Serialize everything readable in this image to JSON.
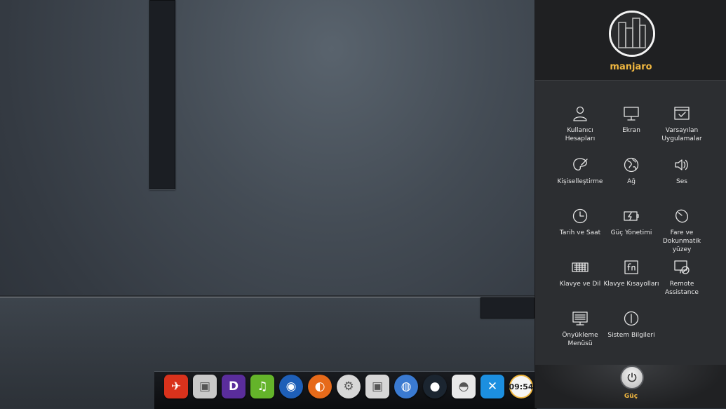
{
  "user": {
    "name": "manjaro"
  },
  "settings_tiles": [
    {
      "label": "Kullanıcı Hesapları",
      "icon": "user-icon"
    },
    {
      "label": "Ekran",
      "icon": "monitor-icon"
    },
    {
      "label": "Varsayılan Uygulamalar",
      "icon": "default-apps-icon"
    },
    {
      "label": "Kişiselleştirme",
      "icon": "palette-icon"
    },
    {
      "label": "Ağ",
      "icon": "globe-icon"
    },
    {
      "label": "Ses",
      "icon": "speaker-icon"
    },
    {
      "label": "Tarih ve Saat",
      "icon": "clock-icon"
    },
    {
      "label": "Güç Yönetimi",
      "icon": "battery-icon"
    },
    {
      "label": "Fare ve Dokunmatik yüzey",
      "icon": "mouse-icon"
    },
    {
      "label": "Klavye ve Dil",
      "icon": "keyboard-icon"
    },
    {
      "label": "Klavye Kısayolları",
      "icon": "fn-key-icon"
    },
    {
      "label": "Remote Assistance",
      "icon": "remote-icon"
    },
    {
      "label": "Önyükleme Menüsü",
      "icon": "boot-menu-icon"
    },
    {
      "label": "Sistem Bilgileri",
      "icon": "info-icon"
    }
  ],
  "power": {
    "label": "Güç"
  },
  "dock": {
    "clock_text": "09:54",
    "apps": [
      {
        "name": "launcher-rocket-icon",
        "color": "#d9321c"
      },
      {
        "name": "software-center-icon",
        "color": "#c9c9c9"
      },
      {
        "name": "deepin-music-icon",
        "color": "#5a2d9c"
      },
      {
        "name": "music-player-icon",
        "color": "#64b42a"
      },
      {
        "name": "browser-globe-icon",
        "color": "#1e5fb8"
      },
      {
        "name": "firefox-icon",
        "color": "#e66a1a"
      },
      {
        "name": "settings-center-icon",
        "color": "#d7d7d7"
      },
      {
        "name": "package-manager-icon",
        "color": "#d6d6d6"
      },
      {
        "name": "network-globe-icon",
        "color": "#3a7ad1"
      },
      {
        "name": "camera-icon",
        "color": "#1b2530"
      },
      {
        "name": "mouse-app-icon",
        "color": "#e8e8e8"
      },
      {
        "name": "remote-app-icon",
        "color": "#1c8fe0"
      },
      {
        "name": "clock-widget-icon",
        "color": "#f5f5f5"
      }
    ]
  }
}
